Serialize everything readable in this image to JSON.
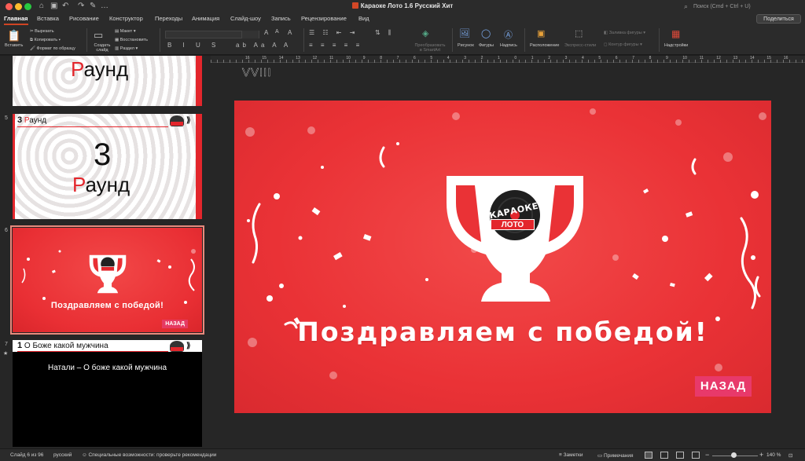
{
  "window": {
    "title": "Караоке Лото 1.6 Русский Хит",
    "search_placeholder": "Поиск (Cmd + Ctrl + U)"
  },
  "tabs": [
    "Главная",
    "Вставка",
    "Рисование",
    "Конструктор",
    "Переходы",
    "Анимация",
    "Слайд-шоу",
    "Запись",
    "Рецензирование",
    "Вид"
  ],
  "share_label": "Поделиться",
  "ribbon": {
    "paste": "Вставить",
    "cut": "Вырезать",
    "copy": "Копировать",
    "format_painter": "Формат по образцу",
    "new_slide": "Создать слайд",
    "layout": "Макет",
    "reset": "Восстановить",
    "section": "Раздел",
    "smartart": "Преобразовать в SmartArt",
    "picture": "Рисунок",
    "shapes": "Фигуры",
    "textbox": "Надпись",
    "arrange": "Расположение",
    "quick_styles": "Экспресс-стили",
    "shape_fill": "Заливка фигуры",
    "shape_outline": "Контур фигуры",
    "addins": "Надстройки"
  },
  "thumbnails": {
    "slide4": {
      "word": "аунд",
      "letter": "Р"
    },
    "slide5": {
      "num": "5",
      "head_num": "3",
      "head_word": "Раунд",
      "big_num": "3",
      "letter": "Р",
      "word": "аунд"
    },
    "slide6": {
      "num": "6",
      "congrats": "Поздравляем с победой!",
      "back": "НАЗАД"
    },
    "slide7": {
      "num": "7",
      "head_num": "1",
      "head_title": "О Боже какой мужчина",
      "caption": "Натали – О боже какой мужчина",
      "star": "★"
    }
  },
  "ruler": [
    "16",
    "15",
    "14",
    "13",
    "12",
    "11",
    "10",
    "9",
    "8",
    "7",
    "6",
    "5",
    "4",
    "3",
    "2",
    "1",
    "0",
    "1",
    "2",
    "3",
    "4",
    "5",
    "6",
    "7",
    "8",
    "9",
    "10",
    "11",
    "12",
    "13",
    "14",
    "15",
    "16"
  ],
  "slide": {
    "overflow_text": "VVIII",
    "logo_top": "КАРАОКЕ",
    "logo_bottom": "ЛОТО",
    "congrats": "Поздравляем с победой!",
    "back_button": "НАЗАД"
  },
  "status": {
    "slide_counter": "Слайд 6 из 96",
    "language": "русский",
    "accessibility": "Специальные возможности: проверьте рекомендации",
    "notes": "Заметки",
    "comments": "Примечания",
    "zoom": "140 %"
  },
  "colors": {
    "accent": "#d04423",
    "slide_red": "#ea3236",
    "back_pink": "#e8396a"
  }
}
